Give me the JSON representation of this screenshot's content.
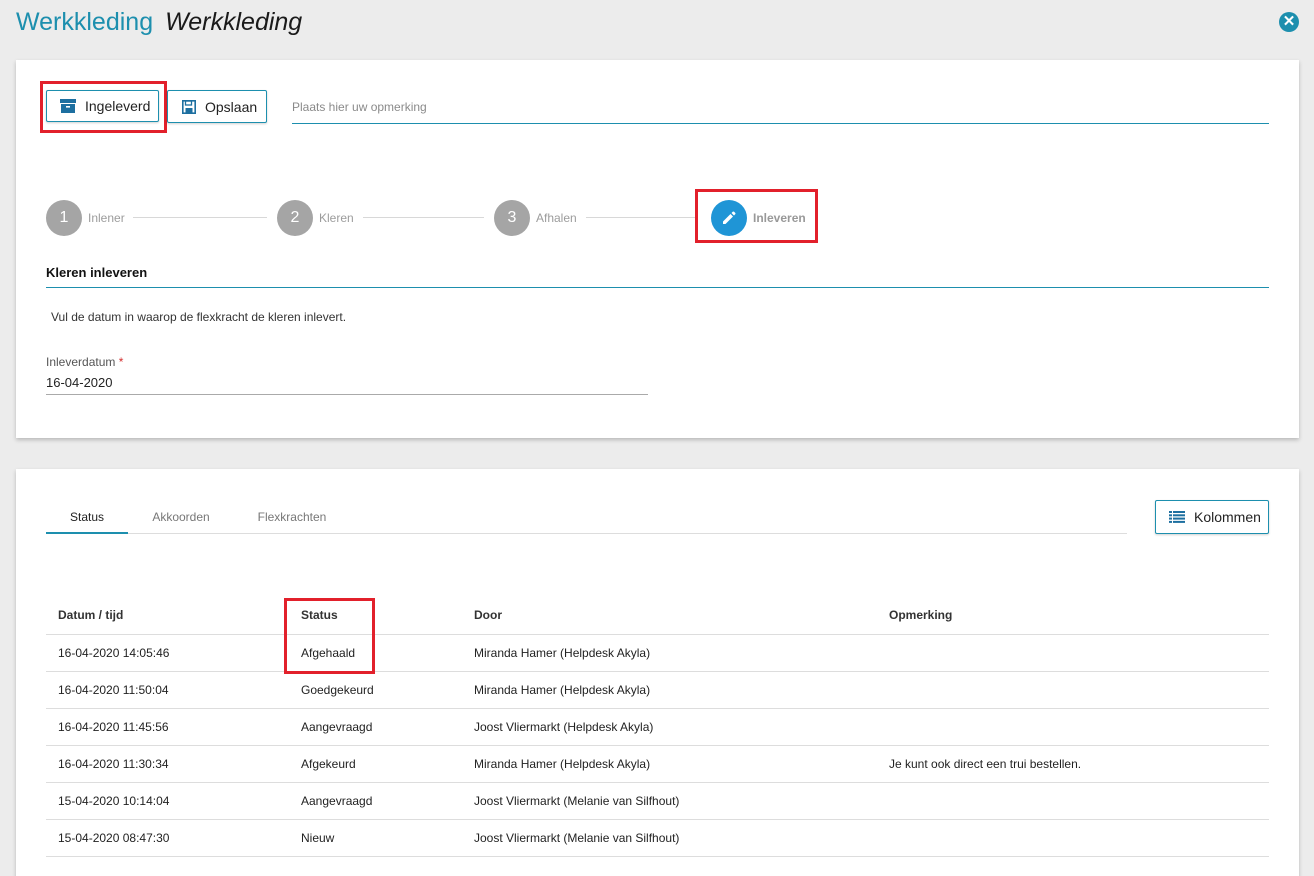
{
  "header": {
    "app_title": "Werkkleding",
    "page_title": "Werkkleding",
    "close_icon": "close-icon"
  },
  "toolbar": {
    "delivered_label": "Ingeleverd",
    "save_label": "Opslaan",
    "remark_placeholder": "Plaats hier uw opmerking"
  },
  "steps": [
    {
      "number": "1",
      "label": "Inlener"
    },
    {
      "number": "2",
      "label": "Kleren"
    },
    {
      "number": "3",
      "label": "Afhalen"
    },
    {
      "icon": "pencil-icon",
      "label": "Inleveren"
    }
  ],
  "section": {
    "title": "Kleren inleveren",
    "description": "Vul de datum in waarop de flexkracht de kleren inlevert.",
    "field_label": "Inleverdatum",
    "required_mark": "*",
    "field_value": "16-04-2020"
  },
  "tabs": [
    "Status",
    "Akkoorden",
    "Flexkrachten"
  ],
  "columns_button": "Kolommen",
  "table": {
    "headers": [
      "Datum / tijd",
      "Status",
      "Door",
      "Opmerking"
    ],
    "rows": [
      [
        "16-04-2020 14:05:46",
        "Afgehaald",
        "Miranda Hamer (Helpdesk Akyla)",
        ""
      ],
      [
        "16-04-2020 11:50:04",
        "Goedgekeurd",
        "Miranda Hamer (Helpdesk Akyla)",
        ""
      ],
      [
        "16-04-2020 11:45:56",
        "Aangevraagd",
        "Joost Vliermarkt (Helpdesk Akyla)",
        ""
      ],
      [
        "16-04-2020 11:30:34",
        "Afgekeurd",
        "Miranda Hamer (Helpdesk Akyla)",
        "Je kunt ook direct een trui bestellen."
      ],
      [
        "15-04-2020 10:14:04",
        "Aangevraagd",
        "Joost Vliermarkt (Melanie van Silfhout)",
        ""
      ],
      [
        "15-04-2020 08:47:30",
        "Nieuw",
        "Joost Vliermarkt (Melanie van Silfhout)",
        ""
      ]
    ]
  },
  "colors": {
    "accent": "#1d8fae",
    "highlight": "#e2202b",
    "step_active": "#1f95d6",
    "step_inactive": "#a5a5a5"
  }
}
